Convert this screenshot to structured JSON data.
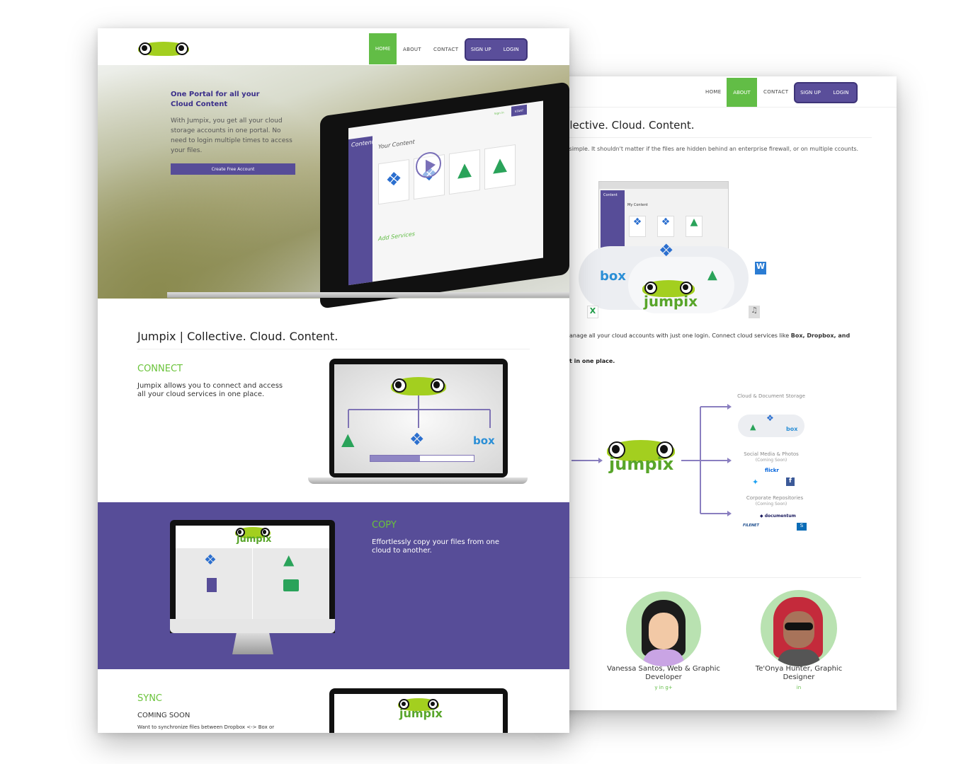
{
  "colors": {
    "accent_green": "#62bd46",
    "brand_purple": "#574d98",
    "frog_green": "#a3cf1f"
  },
  "front": {
    "nav": {
      "home": "HOME",
      "about": "ABOUT",
      "contact": "CONTACT",
      "signup": "SIGN UP",
      "login": "LOGIN"
    },
    "hero": {
      "title": "One Portal for all your Cloud Content",
      "text": "With Jumpix, you get all your cloud storage accounts in one portal. No need to login multiple times to access your files.",
      "cta": "Create Free Account"
    },
    "mock": {
      "sidebar_title": "Content",
      "content_title": "Your Content",
      "add_services": "Add Services",
      "tiles": [
        "dropbox",
        "jumpix",
        "skydrive",
        "gdrive"
      ],
      "signin": "Sign in",
      "start": "START"
    },
    "section_title": "Jumpix | Collective. Cloud. Content.",
    "connect": {
      "title": "CONNECT",
      "text": "Jumpix allows you to connect and access all your cloud services in one place.",
      "box": "box"
    },
    "copy": {
      "title": "COPY",
      "text": "Effortlessly copy your files from one cloud to another.",
      "logo": "jumpix"
    },
    "sync": {
      "title": "SYNC",
      "subtitle": "COMING SOON",
      "text": "Want to synchronize files between Dropbox <-> Box or",
      "logo": "jumpix"
    }
  },
  "back": {
    "nav": {
      "home": "HOME",
      "about": "ABOUT",
      "contact": "CONTACT",
      "signup": "SIGN UP",
      "login": "LOGIN"
    },
    "title": "ollective. Cloud. Content.",
    "intro": "be simple. It shouldn't matter if the files are hidden behind an enterprise firewall, or on multiple ccounts.",
    "mock": {
      "sidebar_title": "Content",
      "content_title": "My Content"
    },
    "cloud": {
      "box": "box",
      "logo": "jumpix",
      "word": "W",
      "excel": "X"
    },
    "desc": "anage all your cloud accounts with just one login. Connect cloud services like ",
    "desc_bold": "Box, Dropbox, and",
    "desc2": "t in one place.",
    "diagram": {
      "logo": "jumpix",
      "branches": [
        {
          "title": "Cloud & Document Storage",
          "sub": ""
        },
        {
          "title": "Social Media & Photos",
          "sub": "(Coming Soon)"
        },
        {
          "title": "Corporate Repositories",
          "sub": "(Coming Soon)"
        }
      ],
      "box": "box",
      "flickr": "flickr",
      "documentum": "documentum",
      "filenet": "FILENET"
    },
    "team": [
      {
        "name": "Vanessa Santos, Web & Graphic Developer",
        "social": "y in g+"
      },
      {
        "name": "Te'Onya Hunter, Graphic Designer",
        "social": "in"
      }
    ]
  }
}
